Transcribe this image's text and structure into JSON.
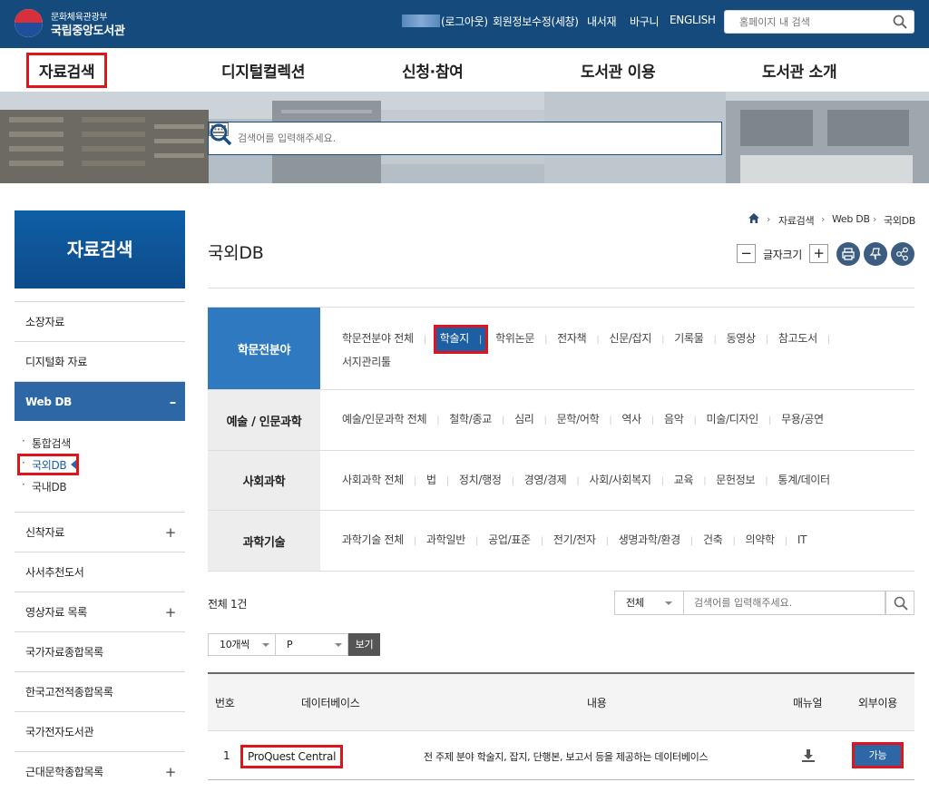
{
  "header": {
    "logo_sub": "문화체육관광부",
    "logo_main": "국립중앙도서관",
    "logout": "(로그아웃)",
    "member": "회원정보수정(세창)",
    "mylib": "내서재",
    "cart": "바구니",
    "english": "ENGLISH",
    "search_placeholder": "홈페이지 내 검색"
  },
  "gnb": [
    "자료검색",
    "디지털컬렉션",
    "신청·참여",
    "도서관 이용",
    "도서관 소개"
  ],
  "hero": {
    "search_placeholder": "검색어를 입력해주세요."
  },
  "lnb": {
    "title": "자료검색",
    "items": [
      "소장자료",
      "디지털화 자료",
      "Web DB",
      "신착자료",
      "사서추천도서",
      "영상자료 목록",
      "국가자료종합목록",
      "한국고전적종합목록",
      "국가전자도서관",
      "근대문학종합목록"
    ],
    "sub": [
      "통합검색",
      "국외DB",
      "국내DB"
    ],
    "plus": "+",
    "minus": "–"
  },
  "page": {
    "title": "국외DB",
    "breadcrumb": [
      "자료검색",
      "Web DB",
      "국외DB"
    ],
    "font_label": "글자크기",
    "font_minus": "−",
    "font_plus": "+"
  },
  "categories": [
    {
      "head": "학문전분야",
      "links": [
        "학문전분야 전체",
        "학술지",
        "학위논문",
        "전자책",
        "신문/잡지",
        "기록물",
        "동영상",
        "참고도서",
        "서지관리툴"
      ]
    },
    {
      "head": "예술 / 인문과학",
      "links": [
        "예술/인문과학 전체",
        "철학/종교",
        "심리",
        "문학/어학",
        "역사",
        "음악",
        "미술/디자인",
        "무용/공연"
      ]
    },
    {
      "head": "사회과학",
      "links": [
        "사회과학 전체",
        "법",
        "정치/행정",
        "경영/경제",
        "사회/사회복지",
        "교육",
        "문헌정보",
        "통계/데이터"
      ]
    },
    {
      "head": "과학기술",
      "links": [
        "과학기술 전체",
        "과학일반",
        "공업/표준",
        "전기/전자",
        "생명과학/환경",
        "건축",
        "의약학",
        "IT"
      ]
    }
  ],
  "list": {
    "total": "전체 1건",
    "filter": "전체",
    "search_placeholder": "검색어를 입력해주세요.",
    "per_page": "10개씩",
    "sort": "P",
    "view": "보기"
  },
  "table": {
    "headers": [
      "번호",
      "데이터베이스",
      "내용",
      "매뉴얼",
      "외부이용"
    ],
    "rows": [
      {
        "no": "1",
        "db": "ProQuest Central",
        "desc": "전 주제 분야 학술지, 잡지, 단행본, 보고서 등을 제공하는 데이터베이스",
        "external": "가능"
      }
    ]
  },
  "colors": {
    "brand": "#144a7c",
    "accent": "#2e67a5",
    "highlight": "#e0141c"
  }
}
